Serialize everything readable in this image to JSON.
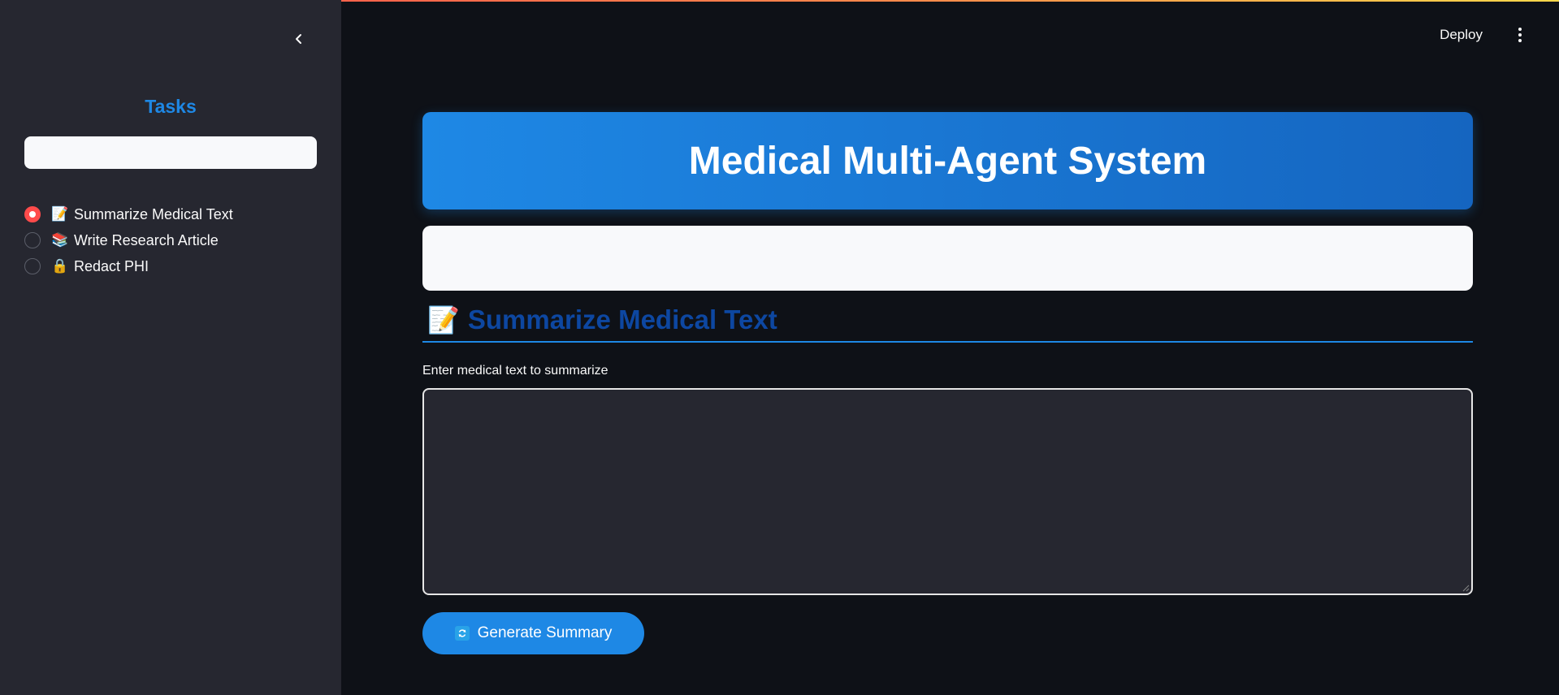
{
  "header": {
    "deploy_label": "Deploy",
    "menu_icon": "more-vertical-icon"
  },
  "sidebar": {
    "collapse_icon": "chevron-left-icon",
    "title": "Tasks",
    "tasks": [
      {
        "emoji": "📝",
        "label": "Summarize Medical Text",
        "selected": true
      },
      {
        "emoji": "📚",
        "label": "Write Research Article",
        "selected": false
      },
      {
        "emoji": "🔒",
        "label": "Redact PHI",
        "selected": false
      }
    ]
  },
  "main": {
    "banner_title": "Medical Multi-Agent System",
    "section": {
      "icon": "📝",
      "title": "Summarize Medical Text"
    },
    "input_label": "Enter medical text to summarize",
    "input_value": "",
    "button_label": "Generate Summary",
    "button_icon": "refresh-icon"
  },
  "colors": {
    "accent": "#1e88e5",
    "radio_selected": "#ff4b4b",
    "section_title": "#0d47a1",
    "background": "#0e1117",
    "sidebar": "#262730"
  }
}
